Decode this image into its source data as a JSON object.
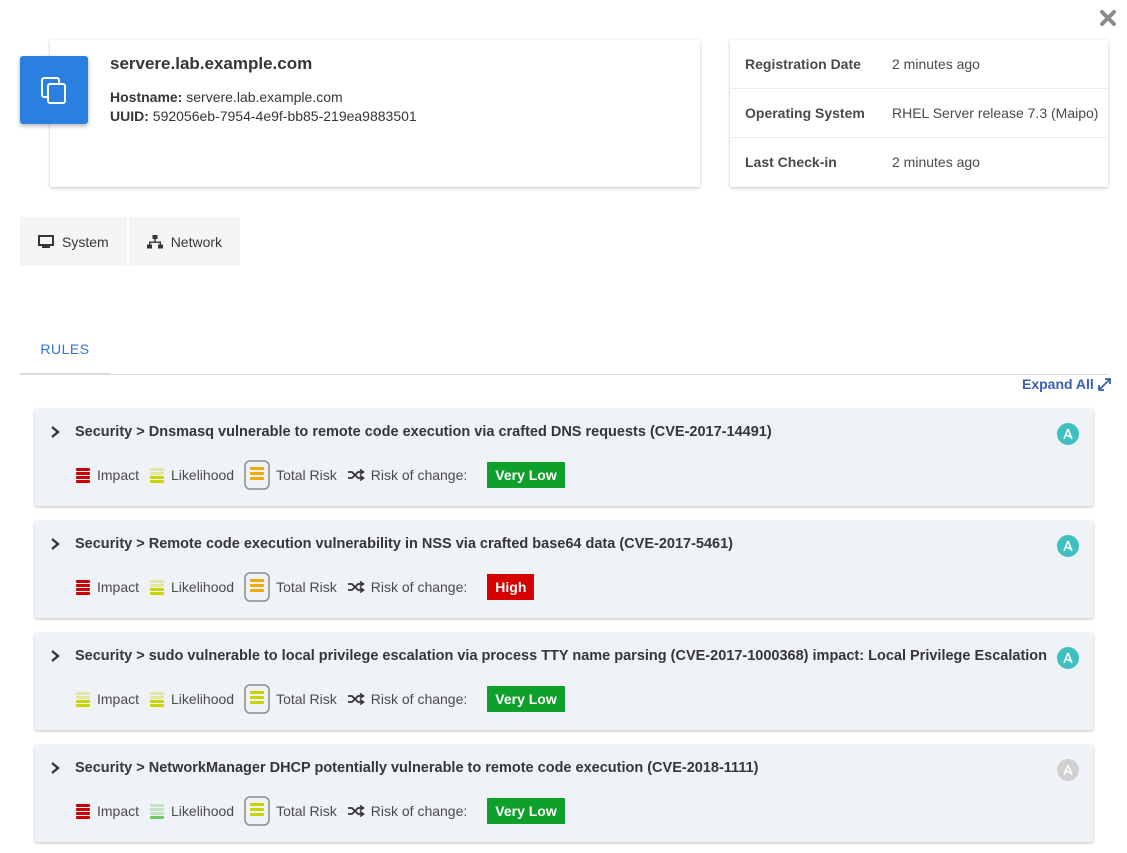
{
  "host": {
    "title": "servere.lab.example.com",
    "hostname_label": "Hostname:",
    "hostname": "servere.lab.example.com",
    "uuid_label": "UUID:",
    "uuid": "592056eb-7954-4e9f-bb85-219ea9883501"
  },
  "info": {
    "rows": [
      {
        "key": "Registration Date",
        "value": "2 minutes ago"
      },
      {
        "key": "Operating System",
        "value": "RHEL Server release 7.3 (Maipo)"
      },
      {
        "key": "Last Check-in",
        "value": "2 minutes ago"
      }
    ]
  },
  "buttons": {
    "system": "System",
    "network": "Network"
  },
  "tabs": {
    "rules": "RULES"
  },
  "expand_all": "Expand All",
  "labels": {
    "impact": "Impact",
    "likelihood": "Likelihood",
    "total_risk": "Total Risk",
    "risk_of_change": "Risk of change:"
  },
  "colors": {
    "accent": "#3273dc",
    "host_icon": "#2b7fe0",
    "very_low": "#0ea02b",
    "high": "#d50000",
    "ansible_on": "#3fbfbf",
    "ansible_off": "#d0d0d0"
  },
  "rules": [
    {
      "title": "Security > Dnsmasq vulnerable to remote code execution via crafted DNS requests (CVE-2017-14491)",
      "impact_level": 4,
      "likelihood_level": 2,
      "total_risk_level": 3,
      "risk_of_change": "Very Low",
      "risk_color": "#0ea02b",
      "ansible": true
    },
    {
      "title": "Security > Remote code execution vulnerability in NSS via crafted base64 data (CVE-2017-5461)",
      "impact_level": 4,
      "likelihood_level": 2,
      "total_risk_level": 3,
      "risk_of_change": "High",
      "risk_color": "#d50000",
      "ansible": true
    },
    {
      "title": "Security > sudo vulnerable to local privilege escalation via process TTY name parsing (CVE-2017-1000368) impact: Local Privilege Escalation",
      "impact_level": 2,
      "likelihood_level": 2,
      "total_risk_level": 2,
      "risk_of_change": "Very Low",
      "risk_color": "#0ea02b",
      "ansible": true
    },
    {
      "title": "Security > NetworkManager DHCP potentially vulnerable to remote code execution (CVE-2018-1111)",
      "impact_level": 4,
      "likelihood_level": 1,
      "total_risk_level": 2,
      "risk_of_change": "Very Low",
      "risk_color": "#0ea02b",
      "ansible": false
    }
  ]
}
